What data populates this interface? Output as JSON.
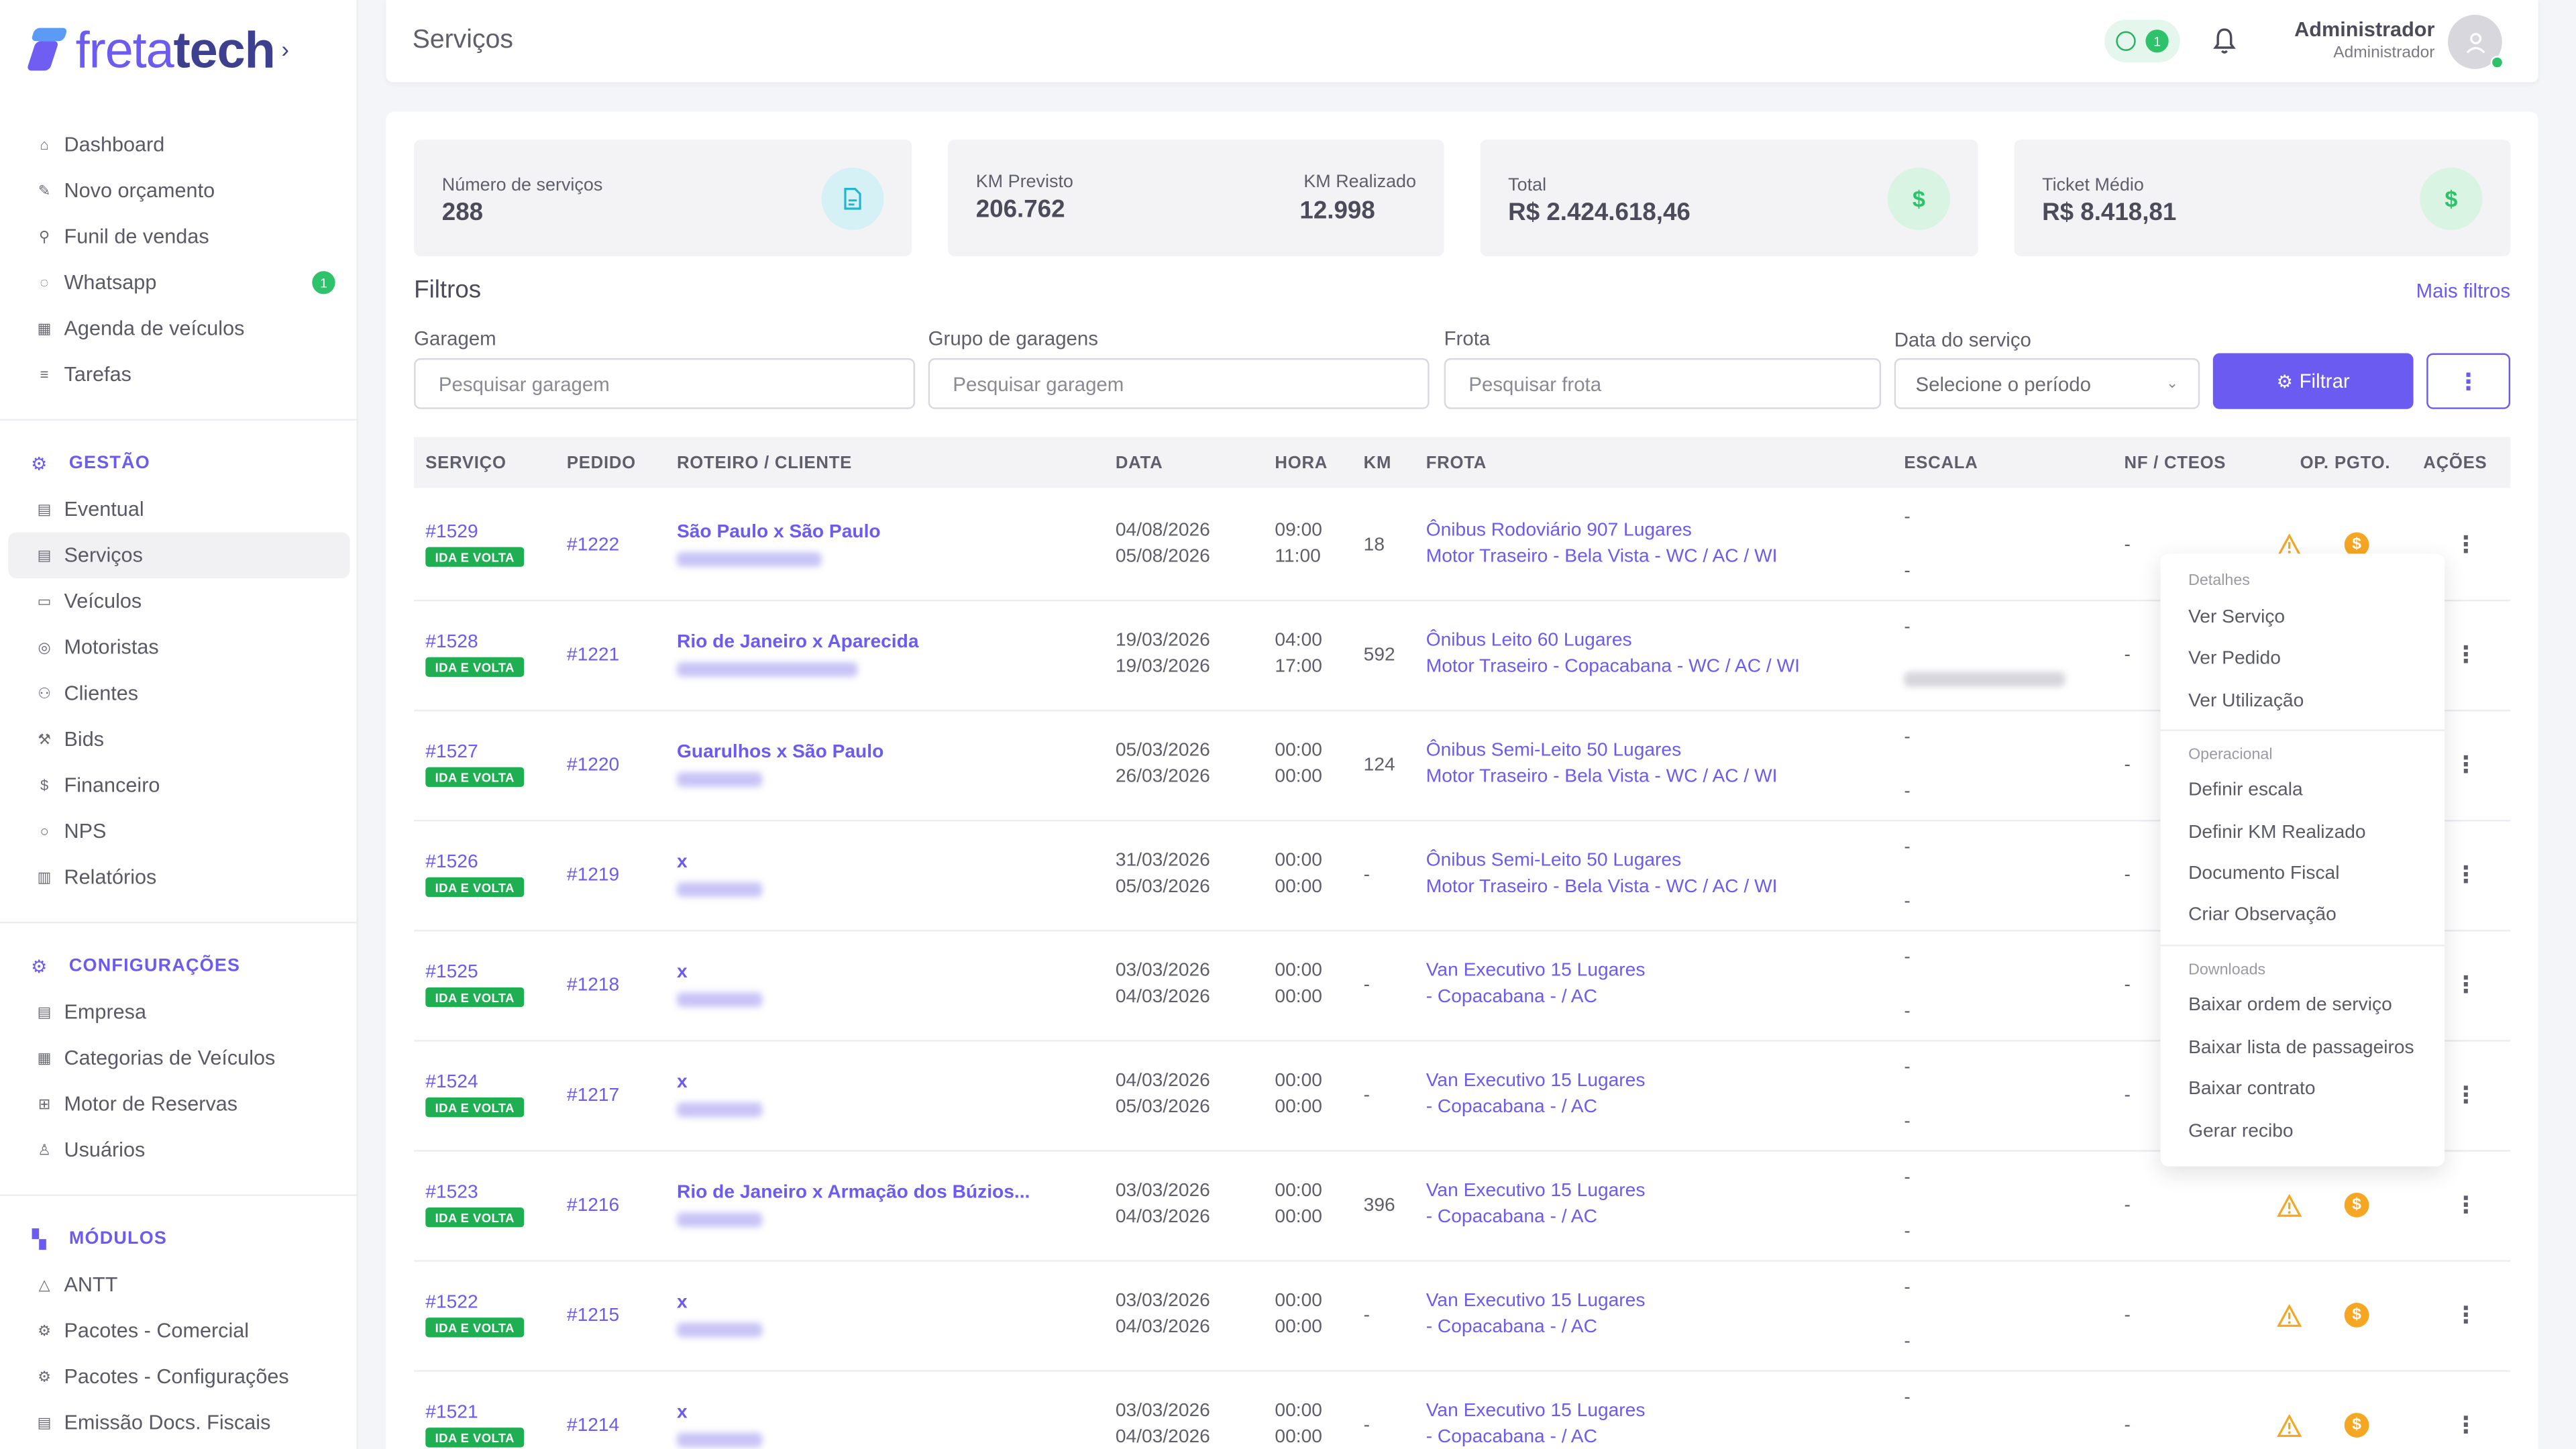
{
  "brand": {
    "logo_light": "freta",
    "logo_bold": "tech",
    "chevron": "›"
  },
  "sidebar": {
    "items": [
      {
        "label": "Dashboard",
        "icon": "home-icon"
      },
      {
        "label": "Novo orçamento",
        "icon": "edit-icon"
      },
      {
        "label": "Funil de vendas",
        "icon": "funnel-icon"
      },
      {
        "label": "Whatsapp",
        "icon": "whatsapp-icon",
        "badge": "1"
      },
      {
        "label": "Agenda de veículos",
        "icon": "calendar-icon"
      },
      {
        "label": "Tarefas",
        "icon": "list-icon"
      }
    ],
    "gestao_title": "GESTÃO",
    "gestao_items": [
      {
        "label": "Eventual",
        "icon": "file-icon"
      },
      {
        "label": "Serviços",
        "icon": "doc-icon",
        "active": true
      },
      {
        "label": "Veículos",
        "icon": "bus-icon"
      },
      {
        "label": "Motoristas",
        "icon": "steering-icon"
      },
      {
        "label": "Clientes",
        "icon": "users-icon"
      },
      {
        "label": "Bids",
        "icon": "gavel-icon"
      },
      {
        "label": "Financeiro",
        "icon": "dollar-icon"
      },
      {
        "label": "NPS",
        "icon": "chat-icon"
      },
      {
        "label": "Relatórios",
        "icon": "report-icon"
      }
    ],
    "config_title": "CONFIGURAÇÕES",
    "config_items": [
      {
        "label": "Empresa",
        "icon": "building-icon"
      },
      {
        "label": "Categorias de Veículos",
        "icon": "grid-icon"
      },
      {
        "label": "Motor de Reservas",
        "icon": "table-icon"
      },
      {
        "label": "Usuários",
        "icon": "user-icon"
      }
    ],
    "modulos_title": "MÓDULOS",
    "modulos_items": [
      {
        "label": "ANTT",
        "icon": "triangle-icon"
      },
      {
        "label": "Pacotes - Comercial",
        "icon": "package-icon"
      },
      {
        "label": "Pacotes - Configurações",
        "icon": "package-icon"
      },
      {
        "label": "Emissão Docs. Fiscais",
        "icon": "receipt-icon"
      }
    ]
  },
  "header": {
    "title": "Serviços",
    "whatsapp_badge": "1",
    "user_name": "Administrador",
    "user_role": "Administrador"
  },
  "stats": {
    "servicos_label": "Número de serviços",
    "servicos_value": "288",
    "km_prev_label": "KM Previsto",
    "km_prev_value": "206.762",
    "km_real_label": "KM Realizado",
    "km_real_value": "12.998",
    "total_label": "Total",
    "total_value": "R$ 2.424.618,46",
    "ticket_label": "Ticket Médio",
    "ticket_value": "R$ 8.418,81"
  },
  "filters": {
    "title": "Filtros",
    "more": "Mais filtros",
    "garagem_label": "Garagem",
    "garagem_placeholder": "Pesquisar garagem",
    "grupo_label": "Grupo de garagens",
    "grupo_placeholder": "Pesquisar garagem",
    "frota_label": "Frota",
    "frota_placeholder": "Pesquisar frota",
    "data_label": "Data do serviço",
    "data_value": "Selecione o período",
    "filter_button": "Filtrar"
  },
  "table": {
    "headers": [
      "SERVIÇO",
      "PEDIDO",
      "ROTEIRO / CLIENTE",
      "DATA",
      "HORA",
      "KM",
      "FROTA",
      "ESCALA",
      "NF / CTEOS",
      "OP.",
      "PGTO.",
      "AÇÕES"
    ],
    "rows": [
      {
        "servico": "#1529",
        "tag": "IDA E VOLTA",
        "pedido": "#1222",
        "roteiro": "São Paulo x São Paulo",
        "data1": "04/08/2026",
        "data2": "05/08/2026",
        "hora1": "09:00",
        "hora2": "11:00",
        "km": "18",
        "frota1": "Ônibus Rodoviário 907 Lugares",
        "frota2": "Motor Traseiro - Bela Vista - WC / AC / WI",
        "esc1": "-",
        "esc2": "-",
        "nf": "-"
      },
      {
        "servico": "#1528",
        "tag": "IDA E VOLTA",
        "pedido": "#1221",
        "roteiro": "Rio de Janeiro x Aparecida",
        "data1": "19/03/2026",
        "data2": "19/03/2026",
        "hora1": "04:00",
        "hora2": "17:00",
        "km": "592",
        "frota1": "Ônibus Leito 60 Lugares",
        "frota2": "Motor Traseiro - Copacabana - WC / AC / WI",
        "esc1": "-",
        "esc2": "",
        "nf": "-"
      },
      {
        "servico": "#1527",
        "tag": "IDA E VOLTA",
        "pedido": "#1220",
        "roteiro": "Guarulhos x São Paulo",
        "data1": "05/03/2026",
        "data2": "26/03/2026",
        "hora1": "00:00",
        "hora2": "00:00",
        "km": "124",
        "frota1": "Ônibus Semi-Leito 50 Lugares",
        "frota2": "Motor Traseiro - Bela Vista - WC / AC / WI",
        "esc1": "-",
        "esc2": "-",
        "nf": "-"
      },
      {
        "servico": "#1526",
        "tag": "IDA E VOLTA",
        "pedido": "#1219",
        "roteiro": "x",
        "data1": "31/03/2026",
        "data2": "05/03/2026",
        "hora1": "00:00",
        "hora2": "00:00",
        "km": "-",
        "frota1": "Ônibus Semi-Leito 50 Lugares",
        "frota2": "Motor Traseiro - Bela Vista - WC / AC / WI",
        "esc1": "-",
        "esc2": "-",
        "nf": "-"
      },
      {
        "servico": "#1525",
        "tag": "IDA E VOLTA",
        "pedido": "#1218",
        "roteiro": "x",
        "data1": "03/03/2026",
        "data2": "04/03/2026",
        "hora1": "00:00",
        "hora2": "00:00",
        "km": "-",
        "frota1": "Van Executivo 15 Lugares",
        "frota2": "- Copacabana - / AC",
        "esc1": "-",
        "esc2": "-",
        "nf": "-"
      },
      {
        "servico": "#1524",
        "tag": "IDA E VOLTA",
        "pedido": "#1217",
        "roteiro": "x",
        "data1": "04/03/2026",
        "data2": "05/03/2026",
        "hora1": "00:00",
        "hora2": "00:00",
        "km": "-",
        "frota1": "Van Executivo 15 Lugares",
        "frota2": "- Copacabana - / AC",
        "esc1": "-",
        "esc2": "-",
        "nf": "-"
      },
      {
        "servico": "#1523",
        "tag": "IDA E VOLTA",
        "pedido": "#1216",
        "roteiro": "Rio de Janeiro x Armação dos Búzios...",
        "data1": "03/03/2026",
        "data2": "04/03/2026",
        "hora1": "00:00",
        "hora2": "00:00",
        "km": "396",
        "frota1": "Van Executivo 15 Lugares",
        "frota2": "- Copacabana - / AC",
        "esc1": "-",
        "esc2": "-",
        "nf": "-"
      },
      {
        "servico": "#1522",
        "tag": "IDA E VOLTA",
        "pedido": "#1215",
        "roteiro": "x",
        "data1": "03/03/2026",
        "data2": "04/03/2026",
        "hora1": "00:00",
        "hora2": "00:00",
        "km": "-",
        "frota1": "Van Executivo 15 Lugares",
        "frota2": "- Copacabana - / AC",
        "esc1": "-",
        "esc2": "-",
        "nf": "-"
      },
      {
        "servico": "#1521",
        "tag": "IDA E VOLTA",
        "pedido": "#1214",
        "roteiro": "x",
        "data1": "03/03/2026",
        "data2": "04/03/2026",
        "hora1": "00:00",
        "hora2": "00:00",
        "km": "-",
        "frota1": "Van Executivo 15 Lugares",
        "frota2": "- Copacabana - / AC",
        "esc1": "-",
        "esc2": "",
        "nf": "-"
      }
    ]
  },
  "dropdown": {
    "detalhes": "Detalhes",
    "ver_servico": "Ver Serviço",
    "ver_pedido": "Ver Pedido",
    "ver_utilizacao": "Ver Utilização",
    "operacional": "Operacional",
    "definir_escala": "Definir escala",
    "definir_km": "Definir KM Realizado",
    "documento_fiscal": "Documento Fiscal",
    "criar_observacao": "Criar Observação",
    "downloads": "Downloads",
    "baixar_os": "Baixar ordem de serviço",
    "baixar_lista": "Baixar lista de passageiros",
    "baixar_contrato": "Baixar contrato",
    "gerar_recibo": "Gerar recibo"
  },
  "colors": {
    "accent": "#6b5bf0",
    "success": "#1fae52",
    "warning": "#f5a623"
  }
}
